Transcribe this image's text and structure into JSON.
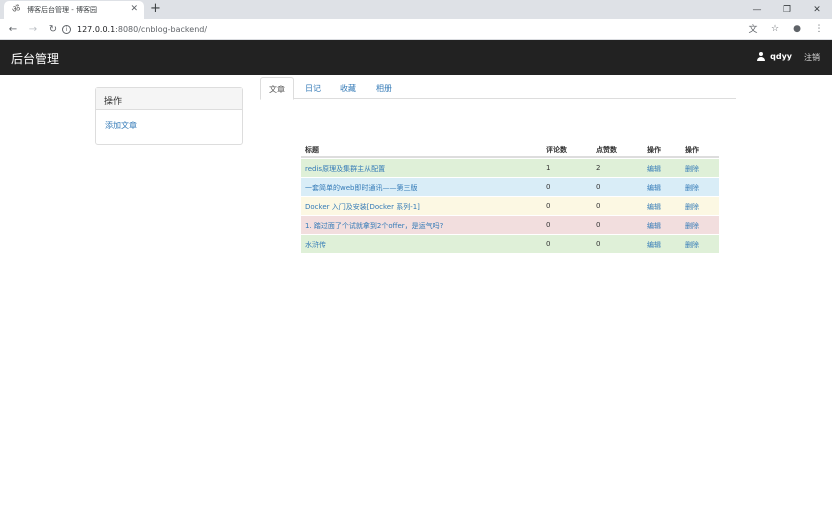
{
  "browser": {
    "tab_title": "博客后台管理 - 博客园",
    "url_host": "127.0.0.1",
    "url_rest": ":8080/cnblog-backend/"
  },
  "navbar": {
    "brand": "后台管理",
    "username": "qdyy",
    "logout": "注销"
  },
  "sidebar": {
    "heading": "操作",
    "link": "添加文章"
  },
  "tabs": [
    "文章",
    "日记",
    "收藏",
    "相册"
  ],
  "table": {
    "headers": [
      "标题",
      "评论数",
      "点赞数",
      "操作",
      "操作"
    ],
    "rows": [
      {
        "title": "redis原理及集群主从配置",
        "comments": "1",
        "likes": "2",
        "edit": "编辑",
        "delete": "删除",
        "style": "success"
      },
      {
        "title": "一套简单的web即时通讯——第三版",
        "comments": "0",
        "likes": "0",
        "edit": "编辑",
        "delete": "删除",
        "style": "info"
      },
      {
        "title": "Docker 入门及安装[Docker 系列-1]",
        "comments": "0",
        "likes": "0",
        "edit": "编辑",
        "delete": "删除",
        "style": "warning"
      },
      {
        "title": "1. 踏过面了个试就拿到2个offer，是运气吗?",
        "comments": "0",
        "likes": "0",
        "edit": "编辑",
        "delete": "删除",
        "style": "danger"
      },
      {
        "title": "水浒传",
        "comments": "0",
        "likes": "0",
        "edit": "编辑",
        "delete": "删除",
        "style": "success"
      }
    ]
  },
  "colors": {
    "navbar_bg": "#222222",
    "link": "#337ab7",
    "row_success": "#dff0d8",
    "row_info": "#d9edf7",
    "row_warning": "#fcf8e3",
    "row_danger": "#f2dede"
  }
}
